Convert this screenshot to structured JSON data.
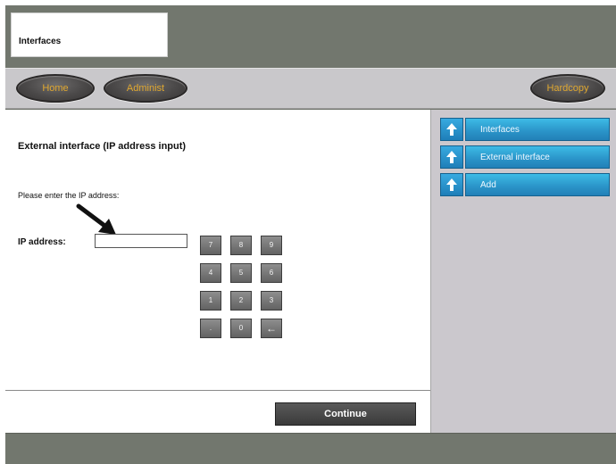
{
  "header": {
    "tab_title": "Interfaces"
  },
  "nav": {
    "home_label": "Home",
    "admin_label": "Administ",
    "hardcopy_label": "Hardcopy"
  },
  "main": {
    "heading": "External interface (IP address input)",
    "prompt": "Please enter the IP address:",
    "ip_label": "IP address:",
    "ip_value": "",
    "keypad": [
      "7",
      "8",
      "9",
      "4",
      "5",
      "6",
      "1",
      "2",
      "3",
      ".",
      "0",
      "←"
    ]
  },
  "sidebar": {
    "items": [
      {
        "label": "Interfaces"
      },
      {
        "label": "External interface"
      },
      {
        "label": "Add"
      }
    ]
  },
  "footer": {
    "continue_label": "Continue"
  },
  "colors": {
    "chrome": "#72776e",
    "nav_bar": "#c9c8cb",
    "sidebar": "#cbc8cd",
    "accent_blue": "#2a93c8",
    "oval_text": "#e0a830"
  }
}
